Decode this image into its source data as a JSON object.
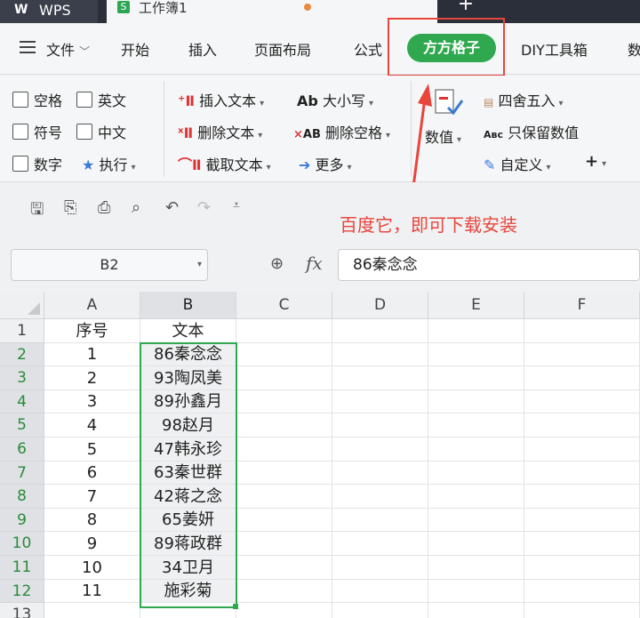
{
  "titlebar": {
    "app_name": "WPS",
    "app_logo": "W",
    "doc_tab": "工作簿1",
    "doc_icon": "S",
    "new_tab": "+"
  },
  "menubar": {
    "file": "文件",
    "items": [
      "开始",
      "插入",
      "页面布局",
      "公式",
      "方方格子",
      "DIY工具箱",
      "数"
    ]
  },
  "ribbon": {
    "checks": [
      "空格",
      "英文",
      "符号",
      "中文",
      "数字"
    ],
    "exec": "执行",
    "insert_text": "插入文本",
    "delete_text": "删除文本",
    "extract_text": "截取文本",
    "case": "大小写",
    "delete_space": "删除空格",
    "more": "更多",
    "value": "数值",
    "round": "四舍五入",
    "keep_value": "只保留数值",
    "custom": "自定义",
    "plus": "+"
  },
  "annotation": "百度它，即可下载安装",
  "formula_bar": {
    "name_box": "B2",
    "fx": "fx",
    "value": "86秦念念"
  },
  "sheet": {
    "columns": [
      "A",
      "B",
      "C",
      "D",
      "E",
      "F"
    ],
    "rows": [
      "1",
      "2",
      "3",
      "4",
      "5",
      "6",
      "7",
      "8",
      "9",
      "10",
      "11",
      "12",
      "13"
    ],
    "col_a": [
      "序号",
      "1",
      "2",
      "3",
      "4",
      "5",
      "6",
      "7",
      "8",
      "9",
      "10",
      "11"
    ],
    "col_b": [
      "文本",
      "86秦念念",
      "93陶凤美",
      "89孙鑫月",
      "98赵月",
      "47韩永珍",
      "63秦世群",
      "42蒋之念",
      "65姜妍",
      "89蒋政群",
      "34卫月",
      "施彩菊"
    ]
  },
  "colors": {
    "accent": "#2fa84f",
    "highlight": "#e8453c",
    "titlebar": "#2b2f3a"
  }
}
